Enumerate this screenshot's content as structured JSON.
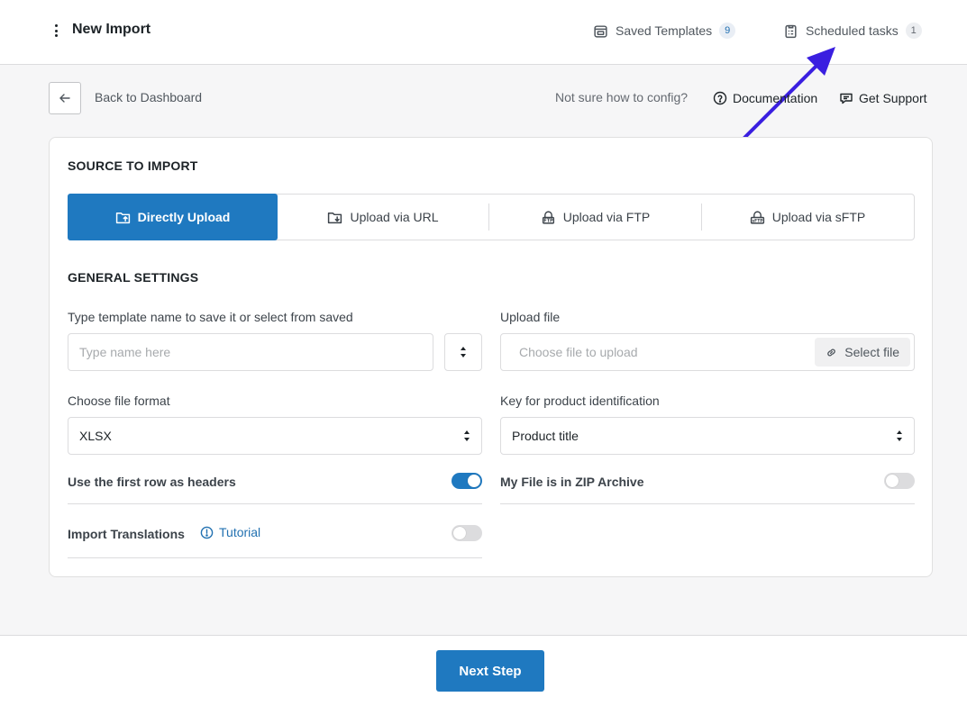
{
  "header": {
    "title": "New Import",
    "saved_templates": {
      "label": "Saved Templates",
      "count": "9"
    },
    "scheduled_tasks": {
      "label": "Scheduled tasks",
      "count": "1"
    }
  },
  "subheader": {
    "back_label": "Back to Dashboard",
    "help_question": "Not sure how to config?",
    "documentation": "Documentation",
    "get_support": "Get Support"
  },
  "source": {
    "title": "SOURCE TO IMPORT",
    "tabs": [
      {
        "label": "Directly Upload",
        "icon": "folder-upload-icon",
        "active": true
      },
      {
        "label": "Upload via URL",
        "icon": "folder-link-icon",
        "active": false
      },
      {
        "label": "Upload via FTP",
        "icon": "ftp-icon",
        "active": false
      },
      {
        "label": "Upload via sFTP",
        "icon": "sftp-icon",
        "active": false
      }
    ]
  },
  "general": {
    "title": "GENERAL SETTINGS",
    "template_label": "Type template name to save it or select from saved",
    "template_placeholder": "Type name here",
    "upload_label": "Upload file",
    "upload_placeholder": "Choose file to upload",
    "select_file": "Select file",
    "format_label": "Choose file format",
    "format_value": "XLSX",
    "key_label": "Key for product identification",
    "key_value": "Product title",
    "first_row_label": "Use the first row as headers",
    "first_row_on": true,
    "zip_label": "My File is in ZIP Archive",
    "zip_on": false,
    "translations_label": "Import Translations",
    "tutorial": "Tutorial",
    "translations_on": false
  },
  "footer": {
    "next": "Next Step"
  },
  "colors": {
    "accent": "#1f79c0",
    "annotation_arrow": "#3a1fe0"
  }
}
